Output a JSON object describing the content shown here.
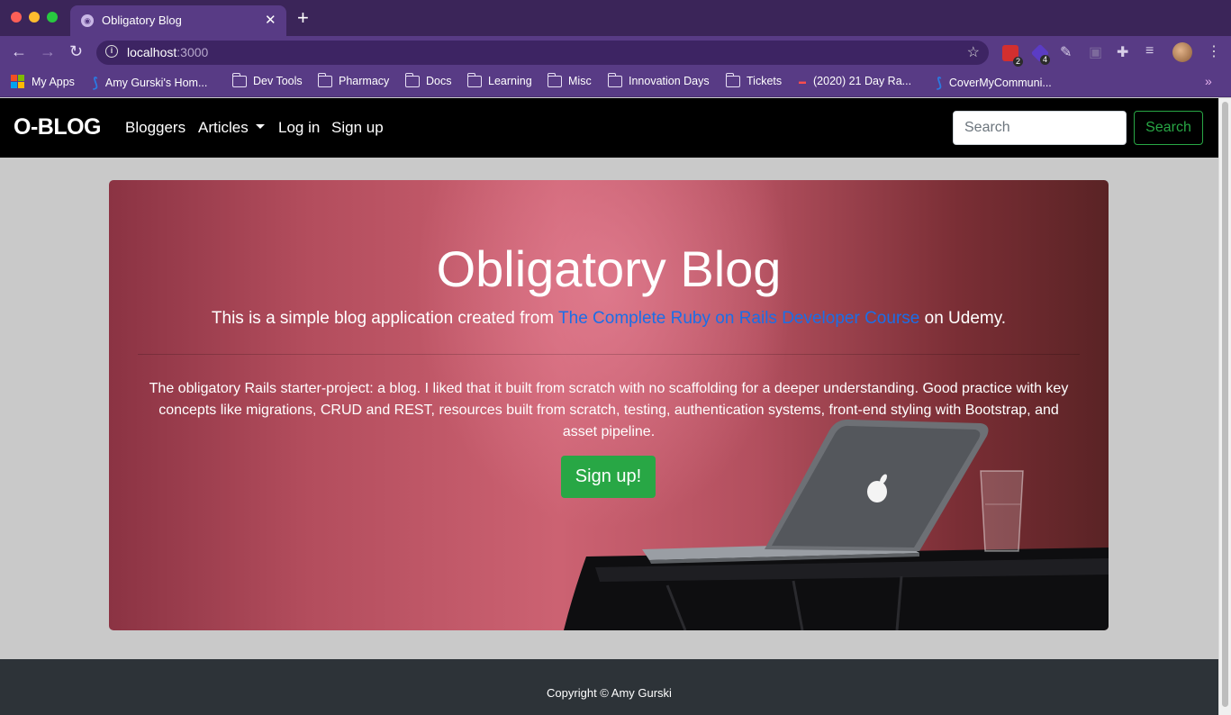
{
  "browser": {
    "tab_title": "Obligatory Blog",
    "tab_close": "✕",
    "new_tab": "+",
    "url_host": "localhost",
    "url_port": ":3000",
    "extensions": [
      {
        "badge": "2",
        "color": "#d32f2f"
      },
      {
        "badge": "4",
        "color": "#5b3cc4"
      }
    ],
    "bookmarks": [
      {
        "label": "My Apps",
        "icon": "apps-grid-icon"
      },
      {
        "label": "Amy Gurski's Hom...",
        "icon": "confluence-icon"
      },
      {
        "label": "Dev Tools",
        "icon": "folder-icon"
      },
      {
        "label": "Pharmacy",
        "icon": "folder-icon"
      },
      {
        "label": "Docs",
        "icon": "folder-icon"
      },
      {
        "label": "Learning",
        "icon": "folder-icon"
      },
      {
        "label": "Misc",
        "icon": "folder-icon"
      },
      {
        "label": "Innovation Days",
        "icon": "folder-icon"
      },
      {
        "label": "Tickets",
        "icon": "folder-icon"
      },
      {
        "label": "(2020) 21 Day Ra...",
        "icon": "site-favicon-icon"
      },
      {
        "label": "CoverMyCommuni...",
        "icon": "confluence-icon"
      }
    ],
    "bookmarks_more": "»"
  },
  "navbar": {
    "brand": "O-BLOG",
    "links": [
      "Bloggers",
      "Articles",
      "Log in",
      "Sign up"
    ],
    "search_placeholder": "Search",
    "search_button": "Search"
  },
  "jumbotron": {
    "title": "Obligatory Blog",
    "lead_before": "This is a simple blog application created from ",
    "lead_link": "The Complete Ruby on Rails Developer Course",
    "lead_after": " on Udemy.",
    "body": "The obligatory Rails starter-project: a blog. I liked that it built from scratch with no scaffolding for a deeper understanding. Good practice with key concepts like migrations, CRUD and REST, resources built from scratch, testing, authentication systems, front-end styling with Bootstrap, and asset pipeline.",
    "cta": "Sign up!"
  },
  "footer": {
    "copyright": "Copyright © Amy Gurski"
  },
  "colors": {
    "success": "#28a745",
    "navbar": "#000000",
    "footer": "#2d3338",
    "link": "#1a6ee8",
    "chrome": "#583b85"
  }
}
